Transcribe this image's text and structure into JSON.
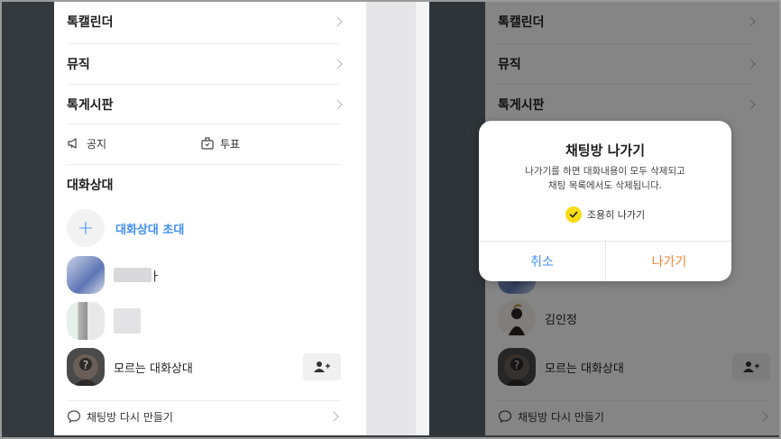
{
  "left": {
    "menu": [
      {
        "label": "톡캘린더"
      },
      {
        "label": "뮤직"
      },
      {
        "label": "톡게시판"
      }
    ],
    "notice_label": "공지",
    "vote_label": "투표",
    "section_title": "대화상대",
    "invite_label": "대화상대 초대",
    "blurred_name_suffix": "ㅏ",
    "unknown_contact": "모르는 대화상대",
    "recreate_label": "채팅방 다시 만들기"
  },
  "right": {
    "menu": [
      {
        "label": "톡캘린더"
      },
      {
        "label": "뮤직"
      },
      {
        "label": "톡게시판"
      }
    ],
    "contact_name": "김인정",
    "unknown_contact": "모르는 대화상대",
    "recreate_label": "채팅방 다시 만들기"
  },
  "dialog": {
    "title": "채팅방 나가기",
    "message_line1": "나가기를 하면 대화내용이 모두 삭제되고",
    "message_line2": "채팅 목록에서도 삭제됩니다.",
    "checkbox_label": "조용히 나가기",
    "checkbox_checked": true,
    "cancel_label": "취소",
    "leave_label": "나가기"
  },
  "colors": {
    "accent_blue": "#3f8ff7",
    "accent_orange": "#f2863a",
    "check_yellow": "#f7dc15"
  }
}
